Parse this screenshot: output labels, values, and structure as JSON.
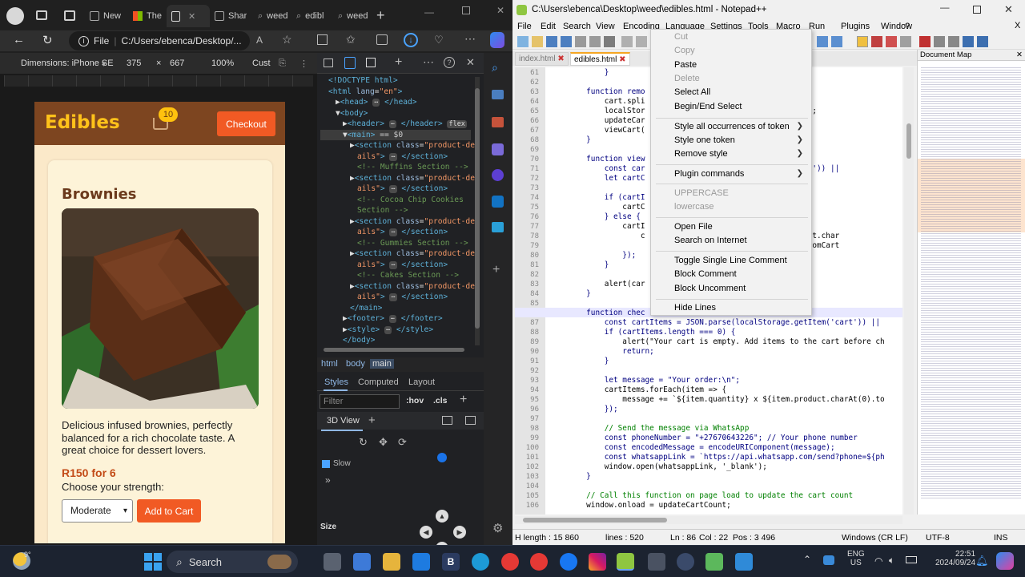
{
  "edge": {
    "tabs": [
      {
        "label": "New"
      },
      {
        "label": "The"
      },
      {
        "label": ""
      },
      {
        "label": "Shar"
      },
      {
        "label": "weed"
      },
      {
        "label": "edibl"
      },
      {
        "label": "weed"
      }
    ],
    "address": {
      "file_label": "File",
      "url": "C:/Users/ebenca/Desktop/..."
    },
    "device_toolbar": {
      "dimensions_label": "Dimensions: iPhone SE",
      "width": "375",
      "times": "×",
      "height": "667",
      "zoom": "100%",
      "custom": "Cust"
    }
  },
  "site": {
    "logo": "Edibles",
    "cart_count": "10",
    "checkout": "Checkout",
    "product": {
      "title": "Brownies",
      "description": "Delicious infused brownies, perfectly balanced for a rich chocolate taste. A great choice for dessert lovers.",
      "price": "R150 for 6",
      "strength_label": "Choose your strength:",
      "strength_value": "Moderate",
      "add_to_cart": "Add to Cart"
    }
  },
  "devtools": {
    "dom_lines": [
      {
        "indent": 0,
        "html": "<span class='tg'>&lt;!DOCTYPE html&gt;</span>"
      },
      {
        "indent": 0,
        "html": "<span class='tg'>&lt;html</span> <span class='at'>lang</span>=<span class='av'>\"en\"</span><span class='tg'>&gt;</span>"
      },
      {
        "indent": 1,
        "html": "▶<span class='tg'>&lt;head&gt;</span> <span class='pill'>⋯</span> <span class='tg'>&lt;/head&gt;</span>"
      },
      {
        "indent": 1,
        "html": "▼<span class='tg'>&lt;body&gt;</span>"
      },
      {
        "indent": 2,
        "html": "▶<span class='tg'>&lt;header&gt;</span> <span class='pill'>⋯</span> <span class='tg'>&lt;/header&gt;</span> <span class='pill'>flex</span>"
      },
      {
        "indent": 2,
        "html": "▼<span class='tg'>&lt;main&gt;</span> <span class='tx'>== $0</span>"
      },
      {
        "indent": 3,
        "html": "▶<span class='tg'>&lt;section</span> <span class='at'>class</span>=<span class='av'>\"product-det</span>"
      },
      {
        "indent": 4,
        "html": "<span class='av'>ails\"</span><span class='tg'>&gt;</span> <span class='pill'>⋯</span> <span class='tg'>&lt;/section&gt;</span>"
      },
      {
        "indent": 4,
        "html": "<span class='cm'>&lt;!-- Muffins Section --&gt;</span>"
      },
      {
        "indent": 3,
        "html": "▶<span class='tg'>&lt;section</span> <span class='at'>class</span>=<span class='av'>\"product-det</span>"
      },
      {
        "indent": 4,
        "html": "<span class='av'>ails\"</span><span class='tg'>&gt;</span> <span class='pill'>⋯</span> <span class='tg'>&lt;/section&gt;</span>"
      },
      {
        "indent": 4,
        "html": "<span class='cm'>&lt;!-- Cocoa Chip Cookies</span>"
      },
      {
        "indent": 4,
        "html": "<span class='cm'>Section --&gt;</span>"
      },
      {
        "indent": 3,
        "html": "▶<span class='tg'>&lt;section</span> <span class='at'>class</span>=<span class='av'>\"product-det</span>"
      },
      {
        "indent": 4,
        "html": "<span class='av'>ails\"</span><span class='tg'>&gt;</span> <span class='pill'>⋯</span> <span class='tg'>&lt;/section&gt;</span>"
      },
      {
        "indent": 4,
        "html": "<span class='cm'>&lt;!-- Gummies Section --&gt;</span>"
      },
      {
        "indent": 3,
        "html": "▶<span class='tg'>&lt;section</span> <span class='at'>class</span>=<span class='av'>\"product-det</span>"
      },
      {
        "indent": 4,
        "html": "<span class='av'>ails\"</span><span class='tg'>&gt;</span> <span class='pill'>⋯</span> <span class='tg'>&lt;/section&gt;</span>"
      },
      {
        "indent": 4,
        "html": "<span class='cm'>&lt;!-- Cakes Section --&gt;</span>"
      },
      {
        "indent": 3,
        "html": "▶<span class='tg'>&lt;section</span> <span class='at'>class</span>=<span class='av'>\"product-det</span>"
      },
      {
        "indent": 4,
        "html": "<span class='av'>ails\"</span><span class='tg'>&gt;</span> <span class='pill'>⋯</span> <span class='tg'>&lt;/section&gt;</span>"
      },
      {
        "indent": 3,
        "html": "<span class='tg'>&lt;/main&gt;</span>"
      },
      {
        "indent": 2,
        "html": "▶<span class='tg'>&lt;footer&gt;</span> <span class='pill'>⋯</span> <span class='tg'>&lt;/footer&gt;</span>"
      },
      {
        "indent": 2,
        "html": "▶<span class='tg'>&lt;style&gt;</span> <span class='pill'>⋯</span> <span class='tg'>&lt;/style&gt;</span>"
      },
      {
        "indent": 2,
        "html": "<span class='tg'>&lt;/body&gt;</span>"
      }
    ],
    "breadcrumbs": [
      "html",
      "body",
      "main"
    ],
    "style_tabs": [
      "Styles",
      "Computed",
      "Layout"
    ],
    "filter_placeholder": "Filter",
    "hov": ":hov",
    "cls": ".cls",
    "threed_label": "3D View",
    "slow_label": "Slow",
    "size_label": "Size"
  },
  "npp": {
    "title": "C:\\Users\\ebenca\\Desktop\\weed\\edibles.html - Notepad++",
    "menu": [
      "File",
      "Edit",
      "Search",
      "View",
      "Encoding",
      "Language",
      "Settings",
      "Tools",
      "Macro",
      "Run",
      "Plugins",
      "Window",
      "?"
    ],
    "tabs": [
      "index.html",
      "edibles.html"
    ],
    "docmap_title": "Document Map",
    "code": [
      {
        "n": "61",
        "t": "            }"
      },
      {
        "n": "62",
        "t": ""
      },
      {
        "n": "63",
        "t": "        function remo"
      },
      {
        "n": "64",
        "t": "            cart.spli"
      },
      {
        "n": "65",
        "t": "            localStor                              (cart));"
      },
      {
        "n": "66",
        "t": "            updateCar"
      },
      {
        "n": "67",
        "t": "            viewCart("
      },
      {
        "n": "68",
        "t": "        }"
      },
      {
        "n": "69",
        "t": ""
      },
      {
        "n": "70",
        "t": "        function view"
      },
      {
        "n": "71",
        "t": "            const car                         etItem('cart')) ||"
      },
      {
        "n": "72",
        "t": "            let cartC"
      },
      {
        "n": "73",
        "t": ""
      },
      {
        "n": "74",
        "t": "            if (cartI"
      },
      {
        "n": "75",
        "t": "                cartC"
      },
      {
        "n": "76",
        "t": "            } else {"
      },
      {
        "n": "77",
        "t": "                cartI"
      },
      {
        "n": "78",
        "t": "                    c                         {item.product.char"
      },
      {
        "n": "79",
        "t": "                                             ick=\"removeFromCart"
      },
      {
        "n": "80",
        "t": "                });"
      },
      {
        "n": "81",
        "t": "            }"
      },
      {
        "n": "82",
        "t": ""
      },
      {
        "n": "83",
        "t": "            alert(car"
      },
      {
        "n": "84",
        "t": "        }"
      },
      {
        "n": "85",
        "t": ""
      },
      {
        "n": "86",
        "t": "        function chec"
      },
      {
        "n": "87",
        "t": "            const cartItems = JSON.parse(localStorage.getItem('cart')) ||"
      },
      {
        "n": "88",
        "t": "            if (cartItems.length === 0) {"
      },
      {
        "n": "89",
        "t": "                alert(\"Your cart is empty. Add items to the cart before ch"
      },
      {
        "n": "90",
        "t": "                return;"
      },
      {
        "n": "91",
        "t": "            }"
      },
      {
        "n": "92",
        "t": ""
      },
      {
        "n": "93",
        "t": "            let message = \"Your order:\\n\";"
      },
      {
        "n": "94",
        "t": "            cartItems.forEach(item => {"
      },
      {
        "n": "95",
        "t": "                message += `${item.quantity} x ${item.product.charAt(0).to"
      },
      {
        "n": "96",
        "t": "            });"
      },
      {
        "n": "97",
        "t": ""
      },
      {
        "n": "98",
        "t": "            // Send the message via WhatsApp"
      },
      {
        "n": "99",
        "t": "            const phoneNumber = \"+27670643226\"; // Your phone number"
      },
      {
        "n": "100",
        "t": "            const encodedMessage = encodeURIComponent(message);"
      },
      {
        "n": "101",
        "t": "            const whatsappLink = `https://api.whatsapp.com/send?phone=${ph"
      },
      {
        "n": "102",
        "t": "            window.open(whatsappLink, '_blank');"
      },
      {
        "n": "103",
        "t": "        }"
      },
      {
        "n": "104",
        "t": ""
      },
      {
        "n": "105",
        "t": "        // Call this function on page load to update the cart count"
      },
      {
        "n": "106",
        "t": "        window.onload = updateCartCount;"
      }
    ],
    "status": {
      "length": "H length : 15 860",
      "lines": "lines : 520",
      "ln": "Ln : 86",
      "col": "Col : 22",
      "pos": "Pos : 3 496",
      "eol": "Windows (CR LF)",
      "enc": "UTF-8",
      "ins": "INS"
    },
    "context_menu": {
      "cut": "Cut",
      "copy": "Copy",
      "paste": "Paste",
      "delete": "Delete",
      "select_all": "Select All",
      "begin_end": "Begin/End Select",
      "style_all": "Style all occurrences of token",
      "style_one": "Style one token",
      "remove_style": "Remove style",
      "plugin_commands": "Plugin commands",
      "uppercase": "UPPERCASE",
      "lowercase": "lowercase",
      "open_file": "Open File",
      "search_internet": "Search on Internet",
      "toggle_comment": "Toggle Single Line Comment",
      "block_comment": "Block Comment",
      "block_uncomment": "Block Uncomment",
      "hide_lines": "Hide Lines"
    }
  },
  "taskbar": {
    "weather": "9°",
    "search": "Search",
    "lang1": "ENG",
    "lang2": "US",
    "time": "22:51",
    "date": "2024/09/24"
  },
  "colors": {
    "brand_brown": "#7d4520",
    "brand_orange": "#f15a24",
    "brand_yellow": "#ffc21a",
    "npp_bg": "#f0f0f0"
  }
}
